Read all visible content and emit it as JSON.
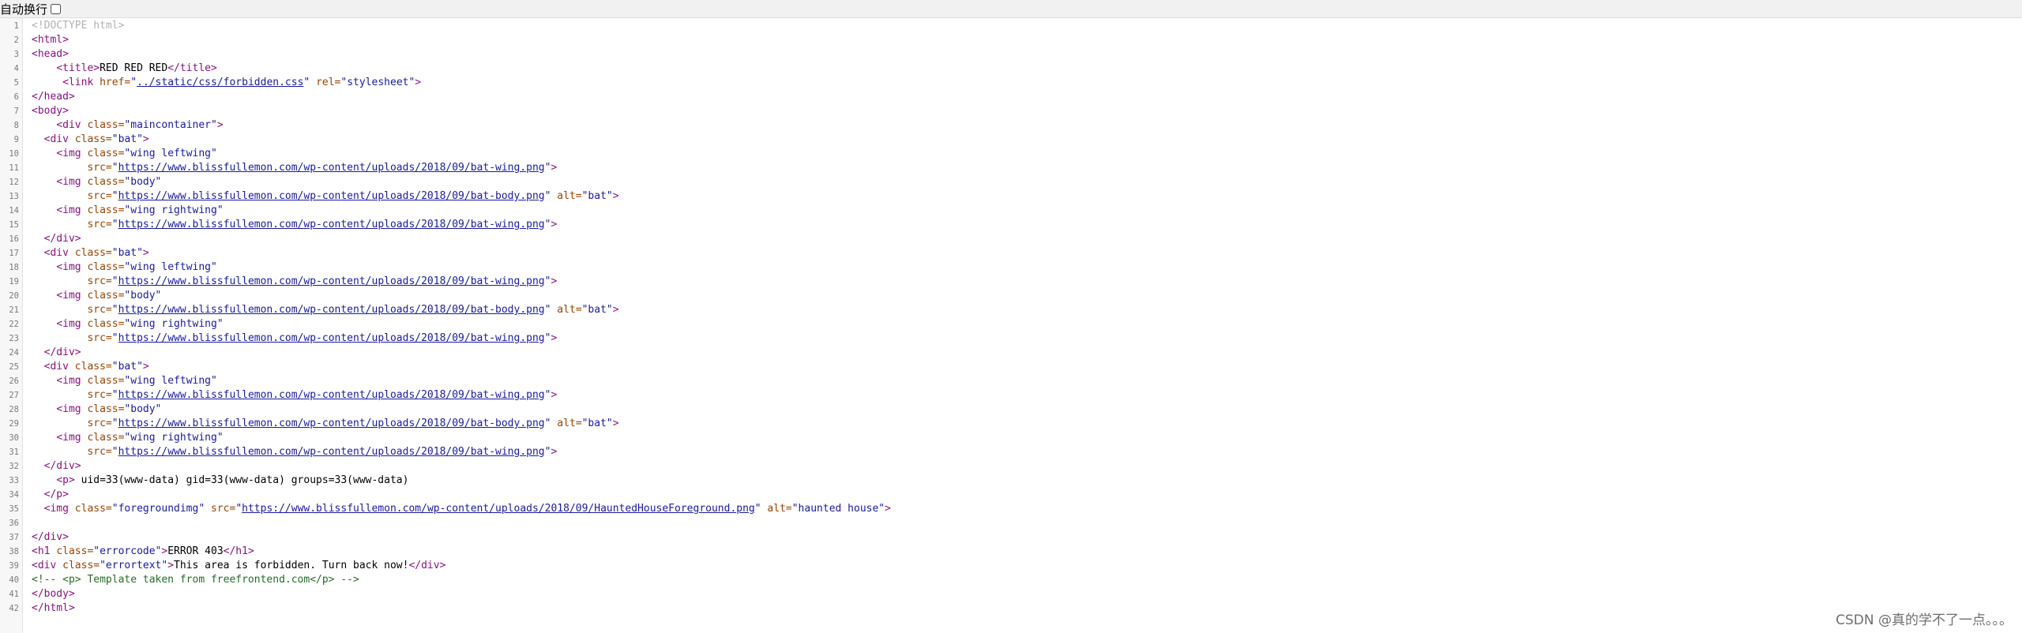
{
  "toolbar": {
    "wrap_label": "自动换行",
    "wrap_checked": false
  },
  "lines": [
    [
      [
        "doc",
        "<!DOCTYPE html>"
      ]
    ],
    [
      [
        "tag",
        "<html>"
      ]
    ],
    [
      [
        "tag",
        "<head>"
      ]
    ],
    [
      [
        "t",
        "    "
      ],
      [
        "tag",
        "<title>"
      ],
      [
        "t",
        "RED RED RED"
      ],
      [
        "tag",
        "</title>"
      ]
    ],
    [
      [
        "t",
        "     "
      ],
      [
        "tag",
        "<link "
      ],
      [
        "attr",
        "href="
      ],
      [
        "val",
        "\""
      ],
      [
        "lnk",
        "../static/css/forbidden.css"
      ],
      [
        "val",
        "\""
      ],
      [
        "t",
        " "
      ],
      [
        "attr",
        "rel="
      ],
      [
        "val",
        "\"stylesheet\""
      ],
      [
        "tag",
        ">"
      ]
    ],
    [
      [
        "tag",
        "</head>"
      ]
    ],
    [
      [
        "tag",
        "<body>"
      ]
    ],
    [
      [
        "t",
        "    "
      ],
      [
        "tag",
        "<div "
      ],
      [
        "attr",
        "class="
      ],
      [
        "val",
        "\"maincontainer\""
      ],
      [
        "tag",
        ">"
      ]
    ],
    [
      [
        "t",
        "  "
      ],
      [
        "tag",
        "<div "
      ],
      [
        "attr",
        "class="
      ],
      [
        "val",
        "\"bat\""
      ],
      [
        "tag",
        ">"
      ]
    ],
    [
      [
        "t",
        "    "
      ],
      [
        "tag",
        "<img "
      ],
      [
        "attr",
        "class="
      ],
      [
        "val",
        "\"wing leftwing\""
      ]
    ],
    [
      [
        "t",
        "         "
      ],
      [
        "attr",
        "src="
      ],
      [
        "val",
        "\""
      ],
      [
        "lnk",
        "https://www.blissfullemon.com/wp-content/uploads/2018/09/bat-wing.png"
      ],
      [
        "val",
        "\""
      ],
      [
        "tag",
        ">"
      ]
    ],
    [
      [
        "t",
        "    "
      ],
      [
        "tag",
        "<img "
      ],
      [
        "attr",
        "class="
      ],
      [
        "val",
        "\"body\""
      ]
    ],
    [
      [
        "t",
        "         "
      ],
      [
        "attr",
        "src="
      ],
      [
        "val",
        "\""
      ],
      [
        "lnk",
        "https://www.blissfullemon.com/wp-content/uploads/2018/09/bat-body.png"
      ],
      [
        "val",
        "\""
      ],
      [
        "t",
        " "
      ],
      [
        "attr",
        "alt="
      ],
      [
        "val",
        "\"bat\""
      ],
      [
        "tag",
        ">"
      ]
    ],
    [
      [
        "t",
        "    "
      ],
      [
        "tag",
        "<img "
      ],
      [
        "attr",
        "class="
      ],
      [
        "val",
        "\"wing rightwing\""
      ]
    ],
    [
      [
        "t",
        "         "
      ],
      [
        "attr",
        "src="
      ],
      [
        "val",
        "\""
      ],
      [
        "lnk",
        "https://www.blissfullemon.com/wp-content/uploads/2018/09/bat-wing.png"
      ],
      [
        "val",
        "\""
      ],
      [
        "tag",
        ">"
      ]
    ],
    [
      [
        "t",
        "  "
      ],
      [
        "tag",
        "</div>"
      ]
    ],
    [
      [
        "t",
        "  "
      ],
      [
        "tag",
        "<div "
      ],
      [
        "attr",
        "class="
      ],
      [
        "val",
        "\"bat\""
      ],
      [
        "tag",
        ">"
      ]
    ],
    [
      [
        "t",
        "    "
      ],
      [
        "tag",
        "<img "
      ],
      [
        "attr",
        "class="
      ],
      [
        "val",
        "\"wing leftwing\""
      ]
    ],
    [
      [
        "t",
        "         "
      ],
      [
        "attr",
        "src="
      ],
      [
        "val",
        "\""
      ],
      [
        "lnk",
        "https://www.blissfullemon.com/wp-content/uploads/2018/09/bat-wing.png"
      ],
      [
        "val",
        "\""
      ],
      [
        "tag",
        ">"
      ]
    ],
    [
      [
        "t",
        "    "
      ],
      [
        "tag",
        "<img "
      ],
      [
        "attr",
        "class="
      ],
      [
        "val",
        "\"body\""
      ]
    ],
    [
      [
        "t",
        "         "
      ],
      [
        "attr",
        "src="
      ],
      [
        "val",
        "\""
      ],
      [
        "lnk",
        "https://www.blissfullemon.com/wp-content/uploads/2018/09/bat-body.png"
      ],
      [
        "val",
        "\""
      ],
      [
        "t",
        " "
      ],
      [
        "attr",
        "alt="
      ],
      [
        "val",
        "\"bat\""
      ],
      [
        "tag",
        ">"
      ]
    ],
    [
      [
        "t",
        "    "
      ],
      [
        "tag",
        "<img "
      ],
      [
        "attr",
        "class="
      ],
      [
        "val",
        "\"wing rightwing\""
      ]
    ],
    [
      [
        "t",
        "         "
      ],
      [
        "attr",
        "src="
      ],
      [
        "val",
        "\""
      ],
      [
        "lnk",
        "https://www.blissfullemon.com/wp-content/uploads/2018/09/bat-wing.png"
      ],
      [
        "val",
        "\""
      ],
      [
        "tag",
        ">"
      ]
    ],
    [
      [
        "t",
        "  "
      ],
      [
        "tag",
        "</div>"
      ]
    ],
    [
      [
        "t",
        "  "
      ],
      [
        "tag",
        "<div "
      ],
      [
        "attr",
        "class="
      ],
      [
        "val",
        "\"bat\""
      ],
      [
        "tag",
        ">"
      ]
    ],
    [
      [
        "t",
        "    "
      ],
      [
        "tag",
        "<img "
      ],
      [
        "attr",
        "class="
      ],
      [
        "val",
        "\"wing leftwing\""
      ]
    ],
    [
      [
        "t",
        "         "
      ],
      [
        "attr",
        "src="
      ],
      [
        "val",
        "\""
      ],
      [
        "lnk",
        "https://www.blissfullemon.com/wp-content/uploads/2018/09/bat-wing.png"
      ],
      [
        "val",
        "\""
      ],
      [
        "tag",
        ">"
      ]
    ],
    [
      [
        "t",
        "    "
      ],
      [
        "tag",
        "<img "
      ],
      [
        "attr",
        "class="
      ],
      [
        "val",
        "\"body\""
      ]
    ],
    [
      [
        "t",
        "         "
      ],
      [
        "attr",
        "src="
      ],
      [
        "val",
        "\""
      ],
      [
        "lnk",
        "https://www.blissfullemon.com/wp-content/uploads/2018/09/bat-body.png"
      ],
      [
        "val",
        "\""
      ],
      [
        "t",
        " "
      ],
      [
        "attr",
        "alt="
      ],
      [
        "val",
        "\"bat\""
      ],
      [
        "tag",
        ">"
      ]
    ],
    [
      [
        "t",
        "    "
      ],
      [
        "tag",
        "<img "
      ],
      [
        "attr",
        "class="
      ],
      [
        "val",
        "\"wing rightwing\""
      ]
    ],
    [
      [
        "t",
        "         "
      ],
      [
        "attr",
        "src="
      ],
      [
        "val",
        "\""
      ],
      [
        "lnk",
        "https://www.blissfullemon.com/wp-content/uploads/2018/09/bat-wing.png"
      ],
      [
        "val",
        "\""
      ],
      [
        "tag",
        ">"
      ]
    ],
    [
      [
        "t",
        "  "
      ],
      [
        "tag",
        "</div>"
      ]
    ],
    [
      [
        "t",
        "    "
      ],
      [
        "tag",
        "<p>"
      ],
      [
        "t",
        " uid=33(www-data) gid=33(www-data) groups=33(www-data)"
      ]
    ],
    [
      [
        "t",
        "  "
      ],
      [
        "tag",
        "</p>"
      ]
    ],
    [
      [
        "t",
        "  "
      ],
      [
        "tag",
        "<img "
      ],
      [
        "attr",
        "class="
      ],
      [
        "val",
        "\"foregroundimg\""
      ],
      [
        "t",
        " "
      ],
      [
        "attr",
        "src="
      ],
      [
        "val",
        "\""
      ],
      [
        "lnk",
        "https://www.blissfullemon.com/wp-content/uploads/2018/09/HauntedHouseForeground.png"
      ],
      [
        "val",
        "\""
      ],
      [
        "t",
        " "
      ],
      [
        "attr",
        "alt="
      ],
      [
        "val",
        "\"haunted house\""
      ],
      [
        "tag",
        ">"
      ]
    ],
    [],
    [
      [
        "tag",
        "</div>"
      ]
    ],
    [
      [
        "tag",
        "<h1 "
      ],
      [
        "attr",
        "class="
      ],
      [
        "val",
        "\"errorcode\""
      ],
      [
        "tag",
        ">"
      ],
      [
        "t",
        "ERROR 403"
      ],
      [
        "tag",
        "</h1>"
      ]
    ],
    [
      [
        "tag",
        "<div "
      ],
      [
        "attr",
        "class="
      ],
      [
        "val",
        "\"errortext\""
      ],
      [
        "tag",
        ">"
      ],
      [
        "t",
        "This area is forbidden. Turn back now!"
      ],
      [
        "tag",
        "</div>"
      ]
    ],
    [
      [
        "cmt",
        "<!-- <p> Template taken from freefrontend.com</p> -->"
      ]
    ],
    [
      [
        "tag",
        "</body>"
      ]
    ],
    [
      [
        "tag",
        "</html>"
      ]
    ]
  ],
  "watermark": "CSDN @真的学不了一点。。。"
}
